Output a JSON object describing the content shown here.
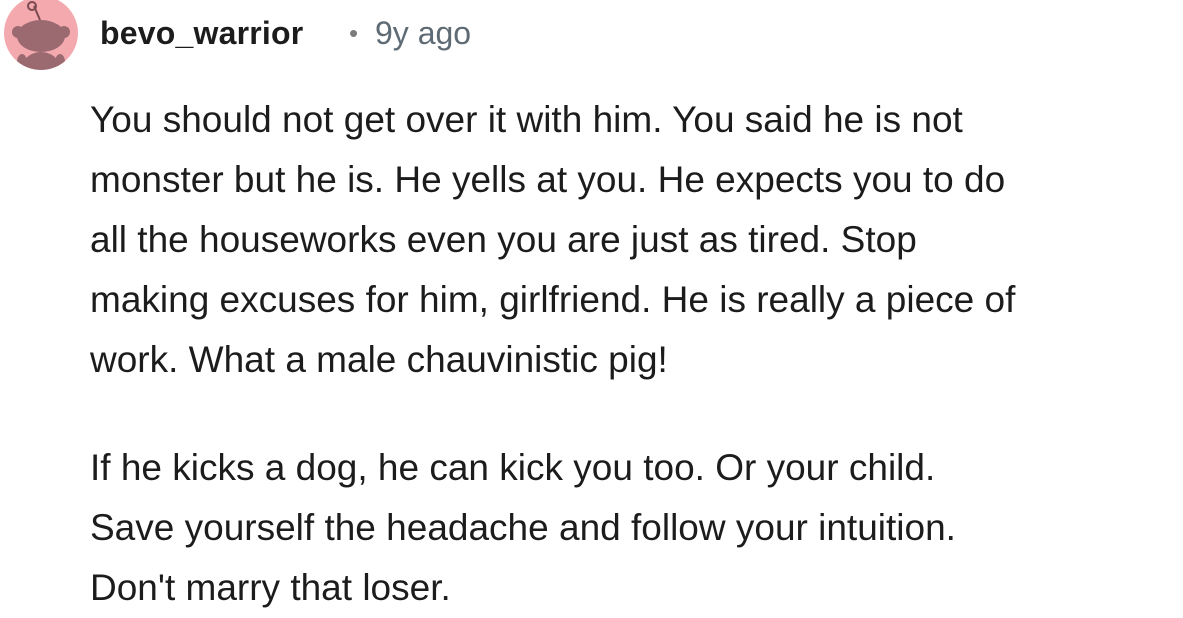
{
  "comment": {
    "author": {
      "username": "bevo_warrior",
      "avatar_icon": "reddit-snoo-avatar-icon",
      "avatar_color": "#f3a9ae"
    },
    "separator": "•",
    "timestamp": "9y ago",
    "paragraphs": [
      "You should not get over it with him. You said he is not\nmonster but he is. He yells at you. He expects you to do\nall the houseworks even you are just as tired. Stop\nmaking excuses for him, girlfriend. He is really a piece of\nwork. What a male chauvinistic pig!",
      "If he kicks a dog, he can kick you too. Or your child.\nSave yourself the headache and follow your intuition.\nDon't marry that loser."
    ]
  }
}
